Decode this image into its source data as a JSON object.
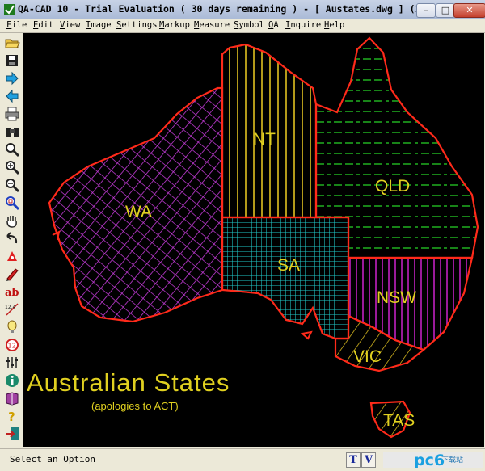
{
  "window": {
    "title": "QA-CAD 10 - Trial Evaluation ( 30 days remaining )  -  [ Austates.dwg ] (1/1)"
  },
  "titlebar_buttons": [
    "minimize-icon",
    "maximize-icon",
    "close-icon"
  ],
  "menu": [
    "File",
    "Edit",
    "View",
    "Image",
    "Settings",
    "Markup",
    "Measure",
    "Symbol",
    "QA",
    "Inquire",
    "Help"
  ],
  "toolbar": {
    "tools": [
      "open-folder-icon",
      "save-disk-icon",
      "arrow-right-icon",
      "arrow-left-icon",
      "print-icon",
      "binoculars-icon",
      "zoom-icon",
      "zoom-in-icon",
      "zoom-out-icon",
      "zoom-window-icon",
      "pan-hand-icon",
      "undo-icon",
      "markup-icon",
      "pencil-icon",
      "text-ab-icon",
      "dimension-ruler-icon",
      "bulb-icon",
      "revision-cloud-icon",
      "layers-icon",
      "info-icon",
      "book-icon",
      "help-icon",
      "exit-icon"
    ],
    "text_tool_label": "ab",
    "dim_label": "12.4",
    "cloud_label": "12"
  },
  "map": {
    "states": [
      "WA",
      "NT",
      "QLD",
      "SA",
      "NSW",
      "VIC",
      "TAS"
    ],
    "title": "Australian  States",
    "subtitle": "(apologies to ACT)",
    "colors": {
      "background": "#000000",
      "outline": "#ff2a1a",
      "wa": "#c43bd8",
      "nt": "#e0c020",
      "qld": "#20b020",
      "sa": "#20c8c8",
      "nsw": "#c020c0",
      "vic": "#e0c020",
      "tas": "#e0c020",
      "label": "#e0d020"
    }
  },
  "status": {
    "text": "Select an Option",
    "buttons": [
      "T",
      "V"
    ]
  },
  "watermark": {
    "brand": "pc6",
    "caption": "下载站"
  }
}
